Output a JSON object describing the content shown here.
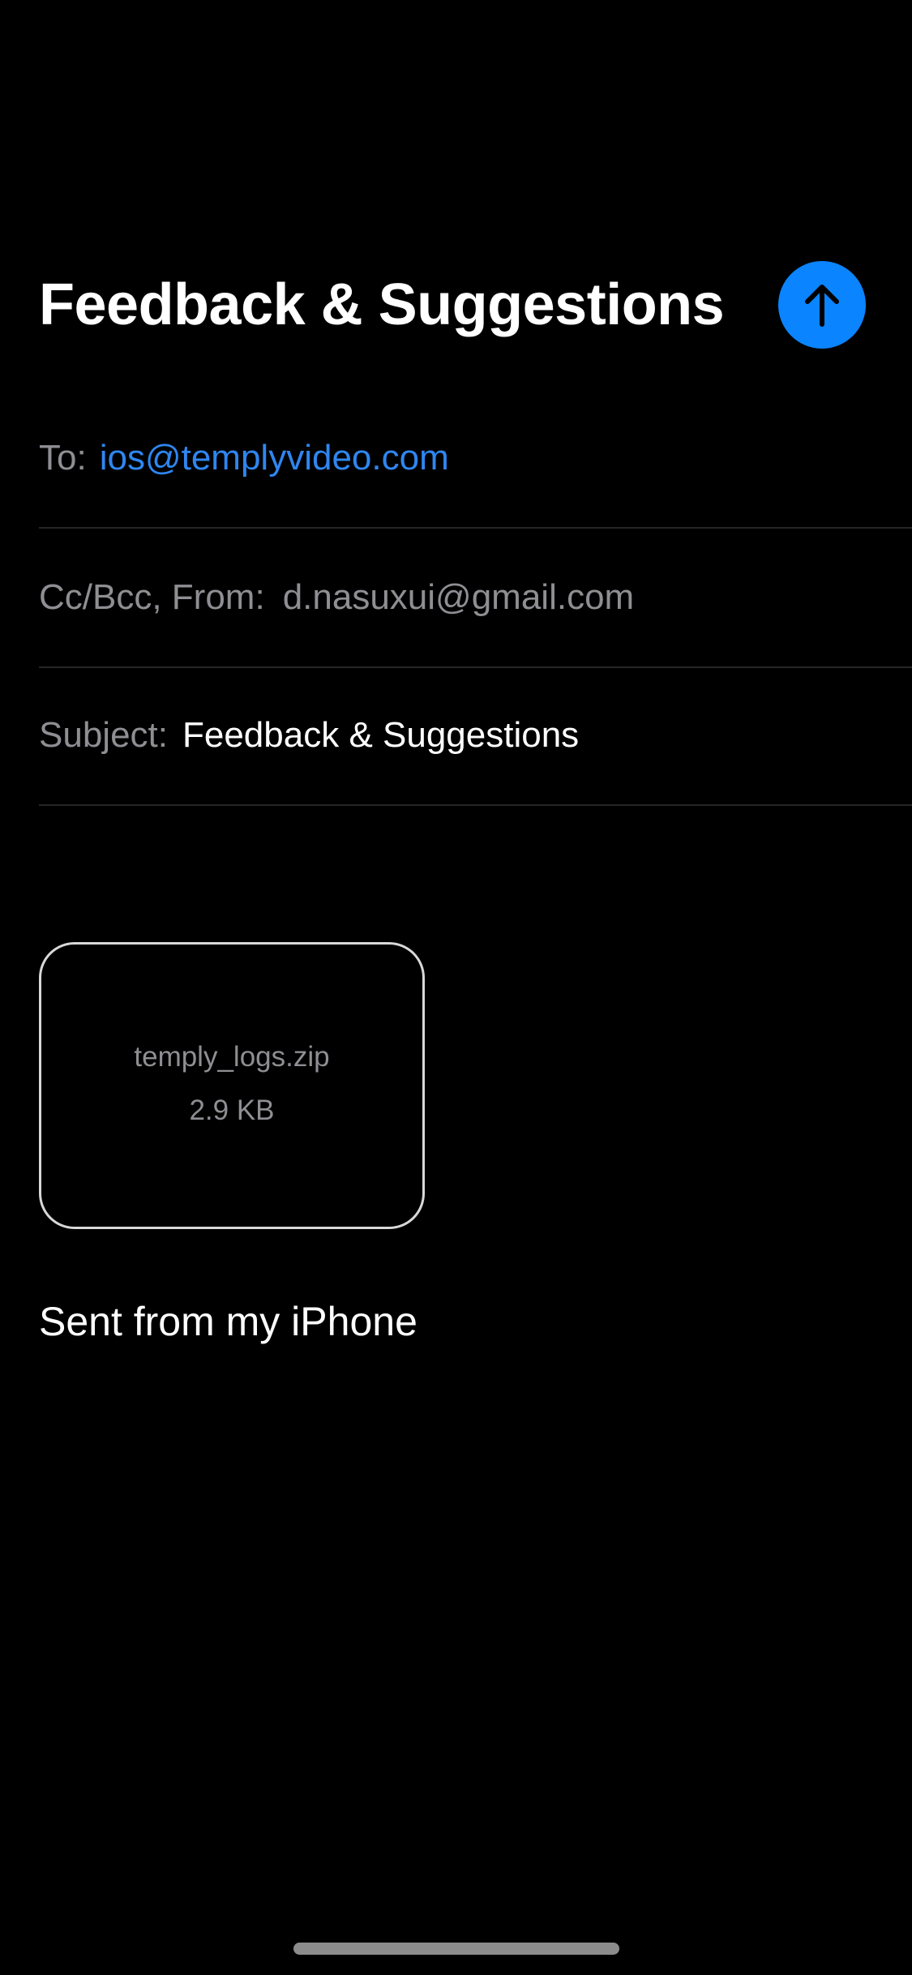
{
  "compose": {
    "title": "Feedback & Suggestions",
    "send_icon": "arrow-up-icon",
    "to": {
      "label": "To:",
      "value": "ios@templyvideo.com"
    },
    "ccbcc_from": {
      "label": "Cc/Bcc, From:",
      "value": "d.nasuxui@gmail.com"
    },
    "subject": {
      "label": "Subject:",
      "value": "Feedback & Suggestions"
    },
    "attachment": {
      "file_name": "temply_logs.zip",
      "file_size": "2.9 KB"
    },
    "signature": "Sent from my iPhone"
  },
  "colors": {
    "background": "#000000",
    "accent": "#0a84ff",
    "link": "#2f86f0",
    "secondary_text": "#8e8e93"
  }
}
